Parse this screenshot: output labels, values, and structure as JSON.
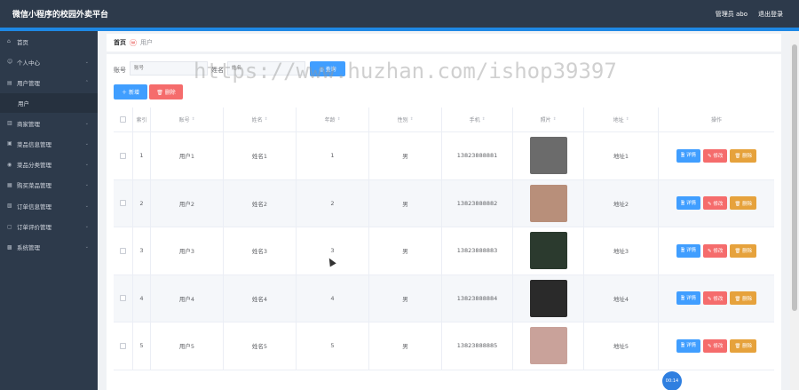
{
  "header": {
    "title": "微信小程序的校园外卖平台",
    "admin_label": "管理员 abo",
    "logout_label": "退出登录"
  },
  "sidebar": {
    "items": [
      {
        "label": "首页",
        "icon": "home-icon",
        "glyph": "⌂"
      },
      {
        "label": "个人中心",
        "icon": "person-icon",
        "glyph": "☺"
      },
      {
        "label": "用户管理",
        "icon": "user-manage-icon",
        "glyph": "▤"
      },
      {
        "label": "商家管理",
        "icon": "merchant-icon",
        "glyph": "▥"
      },
      {
        "label": "菜品信息管理",
        "icon": "dish-info-icon",
        "glyph": "▣"
      },
      {
        "label": "菜品分类管理",
        "icon": "category-icon",
        "glyph": "◉"
      },
      {
        "label": "购买菜品管理",
        "icon": "purchase-icon",
        "glyph": "▦"
      },
      {
        "label": "订单信息管理",
        "icon": "order-info-icon",
        "glyph": "▧"
      },
      {
        "label": "订单评价管理",
        "icon": "review-icon",
        "glyph": "▢"
      },
      {
        "label": "系统管理",
        "icon": "system-icon",
        "glyph": "▩"
      }
    ],
    "submenu_user": "用户",
    "chevron": "⌄"
  },
  "breadcrumb": {
    "home": "首页",
    "sep": "ⓦ",
    "current": "用户"
  },
  "search": {
    "account_label": "账号",
    "account_placeholder": "账号",
    "name_label": "姓名",
    "name_placeholder": "姓名",
    "search_label": "◎ 查询",
    "add_label": "＋ 新增",
    "delete_label": "🗑 删除"
  },
  "table": {
    "columns": [
      "",
      "索引",
      "账号",
      "姓名",
      "年龄",
      "性别",
      "手机",
      "照片",
      "地址",
      "操作"
    ],
    "sort_glyph": "⇕",
    "rows": [
      {
        "index": "1",
        "account": "用户1",
        "name": "姓名1",
        "age": "1",
        "gender": "男",
        "phone": "13823888881",
        "address": "地址1",
        "photo_color": "#6b6b6b"
      },
      {
        "index": "2",
        "account": "用户2",
        "name": "姓名2",
        "age": "2",
        "gender": "男",
        "phone": "13823888882",
        "address": "地址2",
        "photo_color": "#b88f7a"
      },
      {
        "index": "3",
        "account": "用户3",
        "name": "姓名3",
        "age": "3",
        "gender": "男",
        "phone": "13823888883",
        "address": "地址3",
        "photo_color": "#2b3a2e"
      },
      {
        "index": "4",
        "account": "用户4",
        "name": "姓名4",
        "age": "4",
        "gender": "男",
        "phone": "13823888884",
        "address": "地址4",
        "photo_color": "#2a2a2a"
      },
      {
        "index": "5",
        "account": "用户5",
        "name": "姓名5",
        "age": "5",
        "gender": "男",
        "phone": "13823888885",
        "address": "地址5",
        "photo_color": "#c9a29a"
      }
    ],
    "ops": {
      "view": "🗎 详情",
      "edit": "✎ 修改",
      "delete": "🗑 删除"
    }
  },
  "watermark": "https://www.huzhan.com/ishop39397",
  "float_badge": "00:14"
}
